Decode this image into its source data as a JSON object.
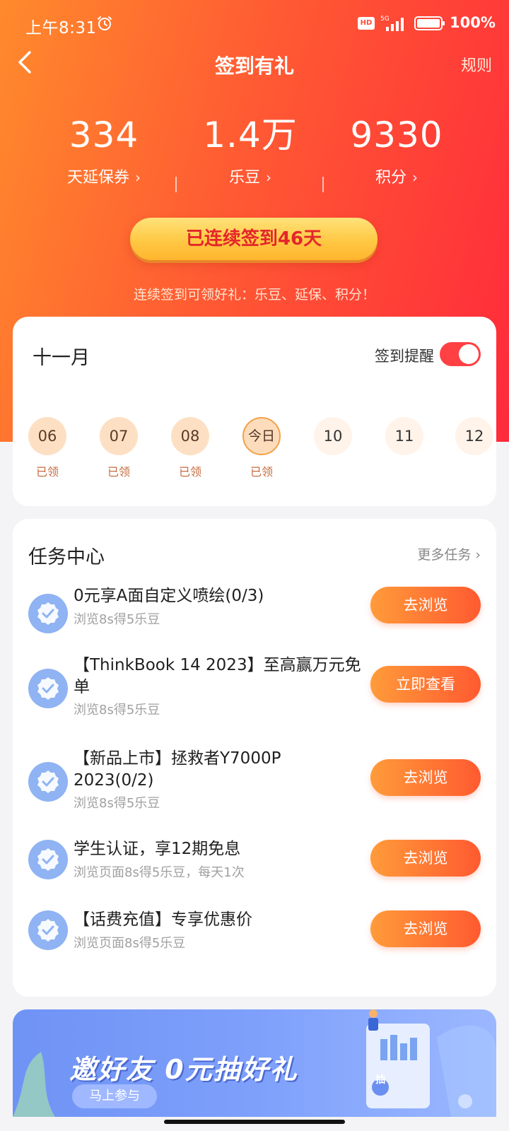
{
  "status_bar": {
    "time": "上午8:31",
    "hd_label": "HD",
    "network": "5G",
    "battery": "100%"
  },
  "nav": {
    "title": "签到有礼",
    "rules": "规则"
  },
  "stats": [
    {
      "value": "334",
      "label": "天延保券"
    },
    {
      "value": "1.4万",
      "label": "乐豆"
    },
    {
      "value": "9330",
      "label": "积分"
    }
  ],
  "checkin": {
    "label": "已连续签到46天",
    "tip": "连续签到可领好礼：乐豆、延保、积分！"
  },
  "calendar": {
    "month": "十一月",
    "remind_label": "签到提醒",
    "remind_on": true,
    "days": [
      {
        "label": "06",
        "status": "已领"
      },
      {
        "label": "07",
        "status": "已领"
      },
      {
        "label": "08",
        "status": "已领"
      },
      {
        "label": "今日",
        "status": "已领"
      },
      {
        "label": "10",
        "status": ""
      },
      {
        "label": "11",
        "status": ""
      },
      {
        "label": "12",
        "status": ""
      }
    ]
  },
  "tasks": {
    "title": "任务中心",
    "more": "更多任务",
    "items": [
      {
        "name": "0元享A面自定义喷绘(0/3)",
        "desc": "浏览8s得5乐豆",
        "button": "去浏览"
      },
      {
        "name": "【ThinkBook 14 2023】至高赢万元免单",
        "desc": "浏览8s得5乐豆",
        "button": "立即查看"
      },
      {
        "name": "【新品上市】拯救者Y7000P 2023(0/2)",
        "desc": "浏览8s得5乐豆",
        "button": "去浏览"
      },
      {
        "name": "学生认证，享12期免息",
        "desc": "浏览页面8s得5乐豆，每天1次",
        "button": "去浏览"
      },
      {
        "name": "【话费充值】专享优惠价",
        "desc": "浏览页面8s得5乐豆",
        "button": "去浏览"
      }
    ]
  },
  "banner": {
    "title": "邀好友 0元抽好礼",
    "cta": "马上参与",
    "badge": "抽"
  },
  "colors": {
    "hero_start": "#ff8a2c",
    "hero_end": "#ff2a3b",
    "accent_button": "#ff5a30",
    "toggle_on": "#ff4144",
    "task_icon": "#8fb3f3"
  }
}
